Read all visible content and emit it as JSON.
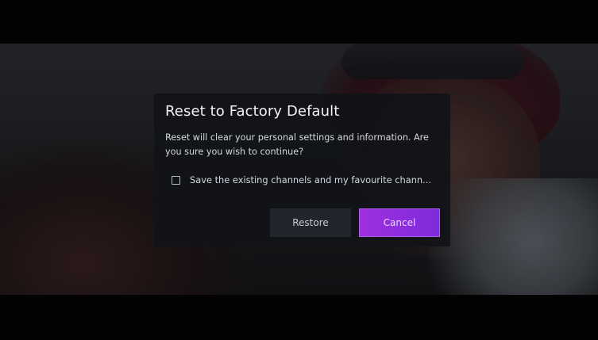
{
  "dialog": {
    "title": "Reset to Factory Default",
    "message": "Reset will clear your personal settings and information. Are you sure you wish to continue?",
    "checkbox": {
      "label": "Save the existing channels and my favourite chann...",
      "checked": false
    },
    "buttons": {
      "restore_label": "Restore",
      "cancel_label": "Cancel"
    }
  },
  "colors": {
    "dialog_background": "#111318",
    "primary_button": "#8e2ddf",
    "secondary_button": "#23252c"
  },
  "icons": {
    "checkbox": "checkbox-unchecked-icon"
  }
}
